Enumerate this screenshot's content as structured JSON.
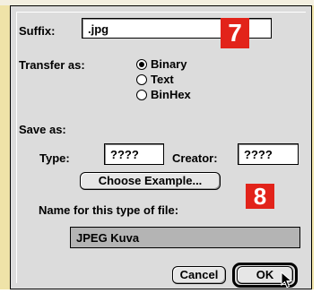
{
  "dialog": {
    "suffix_label": "Suffix:",
    "suffix_value": ".jpg",
    "transfer_label": "Transfer as:",
    "transfer_options": [
      "Binary",
      "Text",
      "BinHex"
    ],
    "transfer_selected": "Binary",
    "save_as_label": "Save as:",
    "type_label": "Type:",
    "type_value": "????",
    "creator_label": "Creator:",
    "creator_value": "????",
    "choose_example_label": "Choose Example...",
    "name_label": "Name for this type of file:",
    "name_value": "JPEG Kuva",
    "cancel_label": "Cancel",
    "ok_label": "OK"
  },
  "callouts": {
    "step_1": "7",
    "step_2": "8"
  },
  "colors": {
    "background": "#efe3a8",
    "dialog": "#dcdcdc",
    "callout": "#e2231a"
  }
}
